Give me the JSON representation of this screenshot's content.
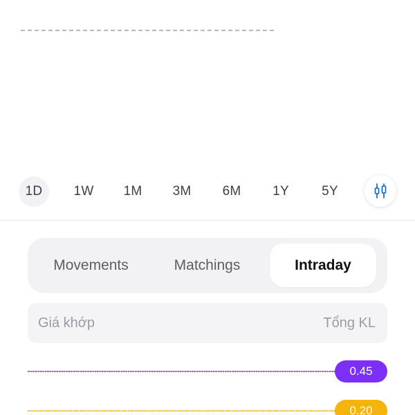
{
  "range_selector": {
    "options": [
      "1D",
      "1W",
      "1M",
      "3M",
      "6M",
      "1Y",
      "5Y"
    ],
    "selected": "1D",
    "chart_type_icon": "candlestick-icon"
  },
  "tabs": {
    "items": [
      "Movements",
      "Matchings",
      "Intraday"
    ],
    "active": "Intraday"
  },
  "table": {
    "col_price": "Giá khớp",
    "col_volume": "Tổng KL"
  },
  "levels": [
    {
      "value": "0.45",
      "color": "#7b2ff7"
    },
    {
      "value": "0.20",
      "color": "#f5b40c"
    }
  ],
  "colors": {
    "accent_blue": "#1e6fd0",
    "segment_bg": "#f2f2f4",
    "reference_line": "#b9b9bd"
  }
}
